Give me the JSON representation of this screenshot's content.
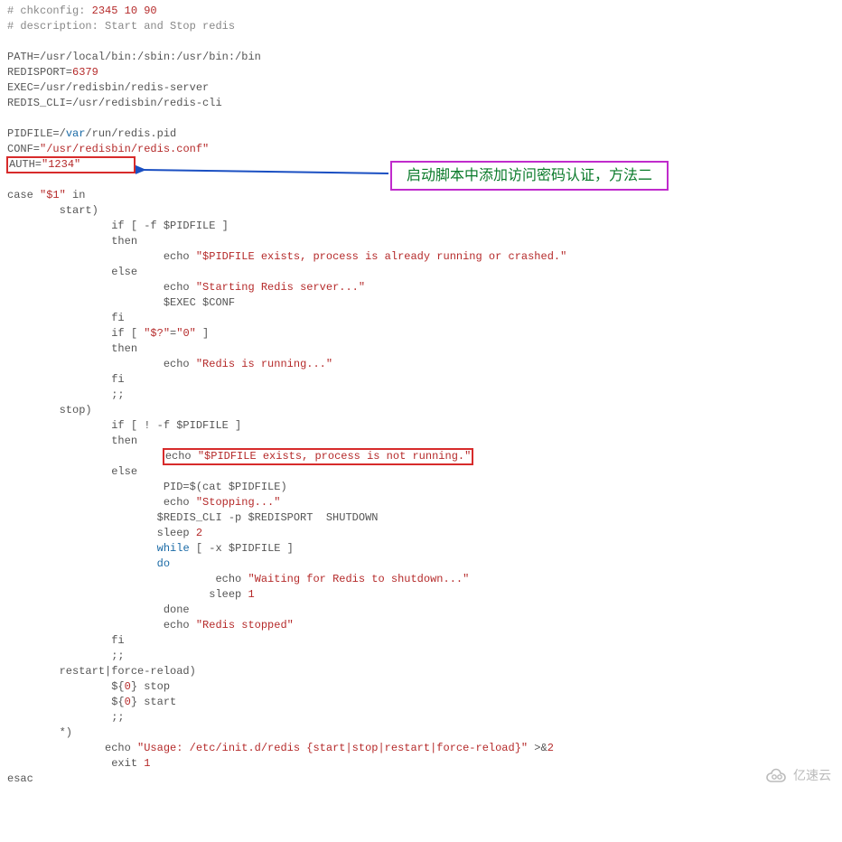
{
  "code": {
    "l1_a": "# chkconfig: ",
    "l1_b": "2345 10 90",
    "l2": "# description: Start and Stop redis",
    "l4": "PATH=/usr/local/bin:/sbin:/usr/bin:/bin",
    "l5_a": "REDISPORT=",
    "l5_b": "6379",
    "l6": "EXEC=/usr/redisbin/redis-server",
    "l7": "REDIS_CLI=/usr/redisbin/redis-cli",
    "l9_a": "PIDFILE=/",
    "l9_b": "var",
    "l9_c": "/run/redis.pid",
    "l10_a": "CONF=",
    "l10_b": "\"/usr/redisbin/redis.conf\"",
    "l11_a": "AUTH=",
    "l11_b": "\"1234\"",
    "l13_a": "case ",
    "l13_b": "\"$1\"",
    "l13_c": " in",
    "l14": "        start)",
    "l15": "                if [ -f $PIDFILE ]",
    "l16": "                then",
    "l17_a": "                        echo ",
    "l17_b": "\"$PIDFILE exists, process is already running or crashed.\"",
    "l18": "                else",
    "l19_a": "                        echo ",
    "l19_b": "\"Starting Redis server...\"",
    "l20": "                        $EXEC $CONF",
    "l21": "                fi",
    "l22_a": "                if [ ",
    "l22_b": "\"$?\"",
    "l22_c": "=",
    "l22_d": "\"0\"",
    "l22_e": " ]",
    "l23": "                then",
    "l24_a": "                        echo ",
    "l24_b": "\"Redis is running...\"",
    "l25": "                fi",
    "l26": "                ;;",
    "l27": "        stop)",
    "l28": "                if [ ! -f $PIDFILE ]",
    "l29": "                then",
    "l30_pad": "                        ",
    "l30_a": "echo ",
    "l30_b": "\"$PIDFILE exists, process is not running.\"",
    "l31": "                else",
    "l32": "                        PID=$(cat $PIDFILE)",
    "l33_a": "                        echo ",
    "l33_b": "\"Stopping...\"",
    "l34": "                       $REDIS_CLI -p $REDISPORT  SHUTDOWN",
    "l35_a": "                       sleep ",
    "l35_b": "2",
    "l36_a": "                       ",
    "l36_b": "while",
    "l36_c": " [ -x $PIDFILE ]",
    "l37_a": "                       ",
    "l37_b": "do",
    "l38_a": "                                echo ",
    "l38_b": "\"Waiting for Redis to shutdown...\"",
    "l39_a": "                               sleep ",
    "l39_b": "1",
    "l40": "                        done",
    "l41_a": "                        echo ",
    "l41_b": "\"Redis stopped\"",
    "l42": "                fi",
    "l43": "                ;;",
    "l44": "        restart|force-reload)",
    "l45_a": "                ${",
    "l45_b": "0",
    "l45_c": "} stop",
    "l46_a": "                ${",
    "l46_b": "0",
    "l46_c": "} start",
    "l47": "                ;;",
    "l48": "        *)",
    "l49_a": "               echo ",
    "l49_b": "\"Usage: /etc/init.d/redis {start|stop|restart|force-reload}\"",
    "l49_c": " >&",
    "l49_d": "2",
    "l50_a": "                exit ",
    "l50_b": "1",
    "l51": "esac"
  },
  "callout_text": "启动脚本中添加访问密码认证，方法二",
  "watermark_text": "亿速云"
}
